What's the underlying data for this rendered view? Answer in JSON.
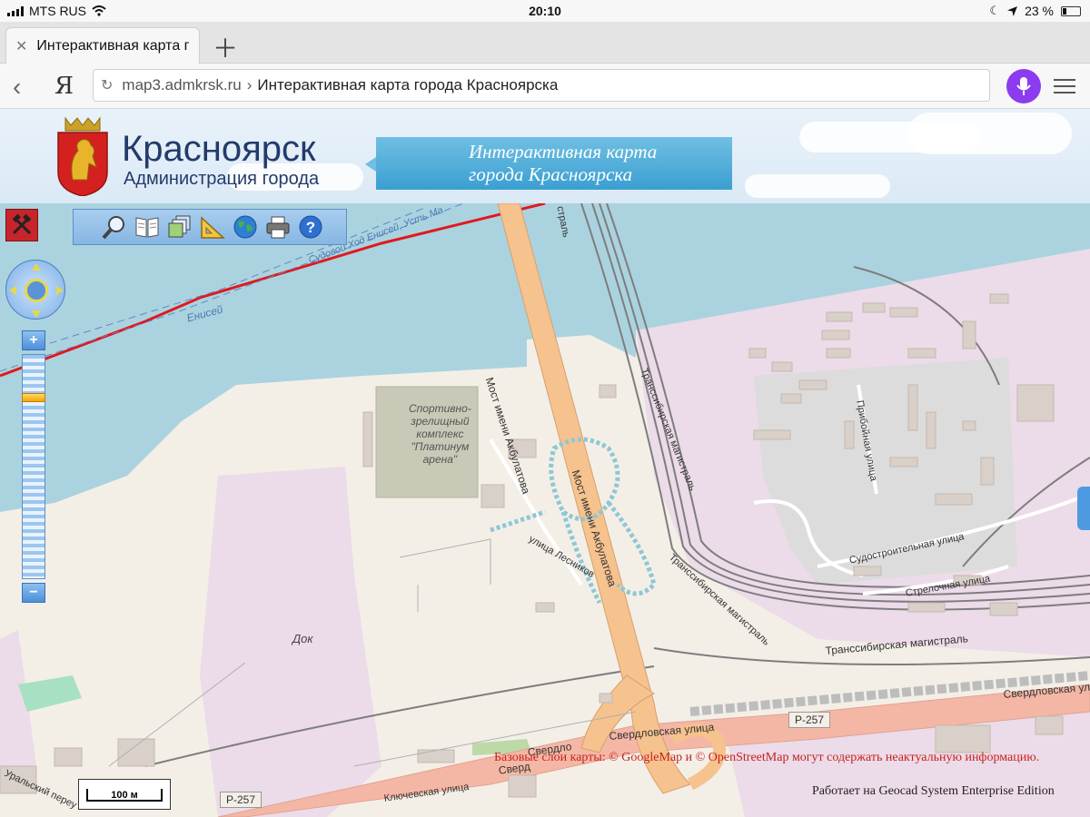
{
  "status_bar": {
    "carrier": "MTS RUS",
    "time": "20:10",
    "battery": "23 %"
  },
  "browser": {
    "tab_title": "Интерактивная карта г",
    "url_domain": "map3.admkrsk.ru",
    "url_separator": "›",
    "url_title": "Интерактивная карта города Красноярска",
    "yandex_logo": "Я"
  },
  "header": {
    "city": "Красноярск",
    "subtitle": "Администрация города",
    "banner_line1": "Интерактивная карта",
    "banner_line2": "города Красноярска"
  },
  "toolbar": {
    "icons": [
      "search-icon",
      "book-icon",
      "layers-icon",
      "ruler-icon",
      "globe-icon",
      "print-icon",
      "help-icon"
    ]
  },
  "zoom": {
    "plus": "+",
    "minus": "−",
    "level_fraction": 0.18
  },
  "map_labels": {
    "arena_line1": "Спортивно-",
    "arena_line2": "зрелищный",
    "arena_line3": "комплекс",
    "arena_line4": "\"Платинум",
    "arena_line5": "арена\"",
    "dock": "Док",
    "bridge1": "Мост имени Акбулатова",
    "bridge2": "Мост имени Акбулатова",
    "fairway": "Судовой Ход Енисей, Усть Ма",
    "river": "Енисей",
    "rail_top": "Транссибирская магистраль",
    "rail_mid": "Транссибирская магистраль",
    "rail_right": "Транссибирская магистраль",
    "rail_label_top": "страль",
    "pribojnaya": "Прибойная улица",
    "sudostroitelnaya": "Судостроительная улица",
    "strelochnaya": "Стрелочная улица",
    "lesnikov": "улица Лесников",
    "sverdlovskaya": "Свердловская улица",
    "sverdlovskaya_right": "Свердловская улиц",
    "sverdlo_left": "Свердло",
    "sverd_left2": "Сверд",
    "klyuchevskaya": "Ключевская улица",
    "uralskiy": "Уральский переу",
    "road_r257_right": "Р-257",
    "road_r257_left": "Р-257"
  },
  "scale": "100 м",
  "credits": "Базовые слои карты: © GoogleMap и © OpenStreetMap могут содержать неактуальную информацию.",
  "powered_by": "Работает на Geocad System Enterprise Edition"
}
